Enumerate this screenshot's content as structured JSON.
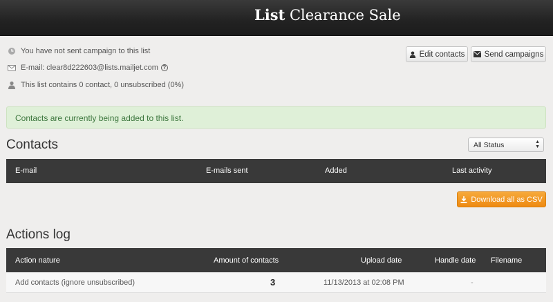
{
  "header": {
    "title_bold": "List",
    "title_rest": " Clearance Sale"
  },
  "info": {
    "campaign_status": "You have not sent campaign to this list",
    "email_label": "E-mail:",
    "email_address": "clear8d222603@lists.mailjet.com",
    "help_glyph": "?",
    "contacts_summary": "This list contains 0 contact, 0 unsubscribed (0%)"
  },
  "toolbar": {
    "edit_contacts_label": "Edit contacts",
    "send_campaigns_label": "Send campaigns"
  },
  "alert": {
    "message": "Contacts are currently being added to this list."
  },
  "contacts": {
    "title": "Contacts",
    "filter": {
      "selected": "All Status"
    },
    "columns": [
      "E-mail",
      "E-mails sent",
      "Added",
      "Last activity"
    ],
    "download_label": "Download all as CSV"
  },
  "actions_log": {
    "title": "Actions log",
    "columns": [
      "Action nature",
      "Amount of contacts",
      "Upload date",
      "Handle date",
      "Filename"
    ],
    "rows": [
      {
        "action": "Add contacts (ignore unsubscribed)",
        "amount": "3",
        "upload_date": "11/13/2013 at 02:08 PM",
        "handle_date": "-",
        "filename": ""
      }
    ]
  },
  "colors": {
    "header_bg": "#222222",
    "alert_bg": "#dff0d8",
    "alert_text": "#3c763d",
    "table_header_bg": "#393939",
    "accent_orange": "#f39c12"
  },
  "icons": [
    "clock-icon",
    "envelope-icon",
    "user-icon",
    "help-icon",
    "person-icon",
    "mail-icon",
    "download-icon"
  ]
}
